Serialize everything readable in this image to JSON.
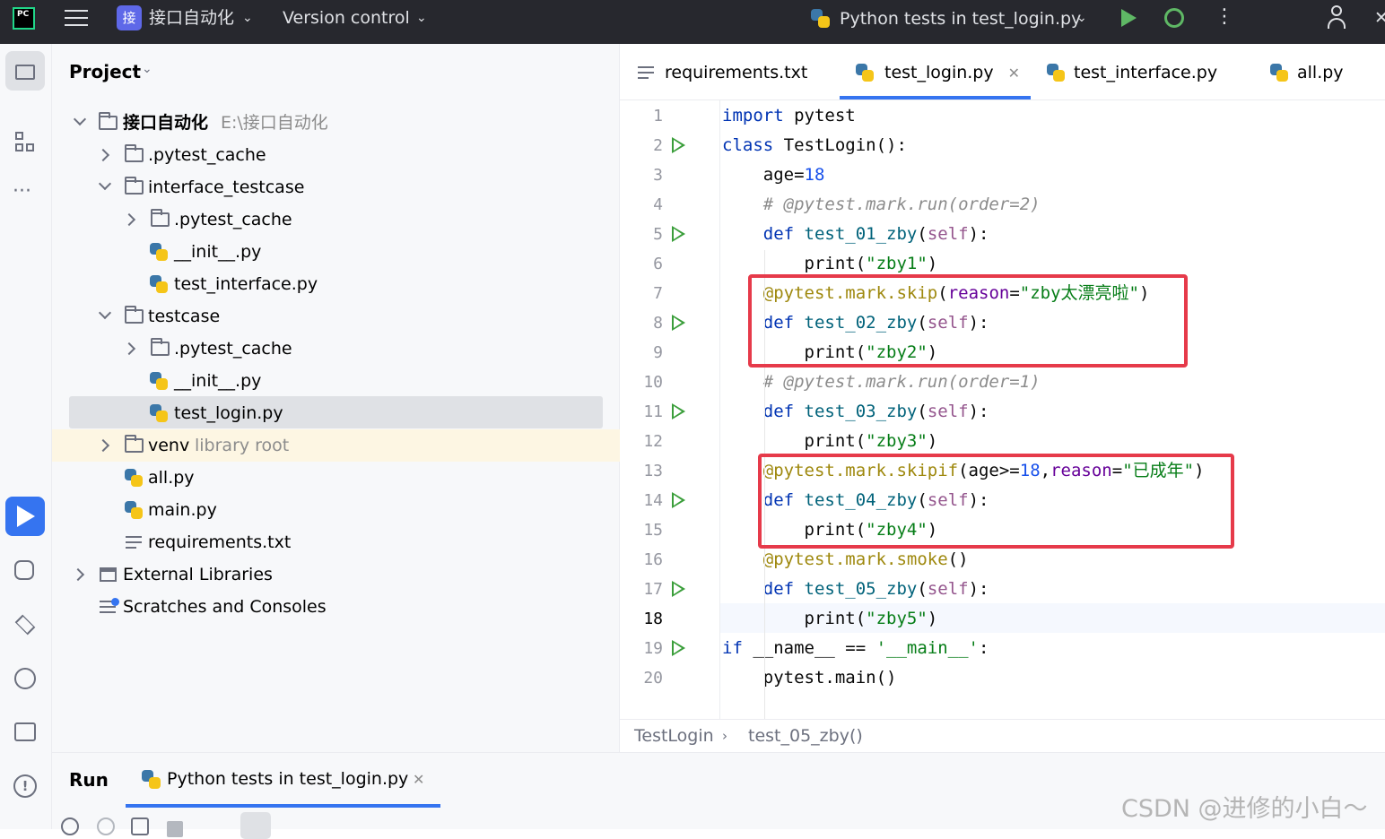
{
  "titlebar": {
    "project_badge": "接",
    "project_name": "接口自动化",
    "vcs_label": "Version control",
    "run_config": "Python tests in test_login.py"
  },
  "project_panel": {
    "title": "Project",
    "tree": [
      {
        "label": "接口自动化",
        "hint": "E:\\接口自动化"
      },
      {
        "label": ".pytest_cache"
      },
      {
        "label": "interface_testcase"
      },
      {
        "label": ".pytest_cache"
      },
      {
        "label": "__init__.py"
      },
      {
        "label": "test_interface.py"
      },
      {
        "label": "testcase"
      },
      {
        "label": ".pytest_cache"
      },
      {
        "label": "__init__.py"
      },
      {
        "label": "test_login.py"
      },
      {
        "label": "venv",
        "hint": "library root"
      },
      {
        "label": "all.py"
      },
      {
        "label": "main.py"
      },
      {
        "label": "requirements.txt"
      },
      {
        "label": "External Libraries"
      },
      {
        "label": "Scratches and Consoles"
      }
    ]
  },
  "editor": {
    "tabs": [
      "requirements.txt",
      "test_login.py",
      "test_interface.py",
      "all.py"
    ],
    "active_tab": "test_login.py",
    "line_numbers": [
      "1",
      "2",
      "3",
      "4",
      "5",
      "6",
      "7",
      "8",
      "9",
      "10",
      "11",
      "12",
      "13",
      "14",
      "15",
      "16",
      "17",
      "18",
      "19",
      "20"
    ],
    "code": {
      "l1": [
        "import",
        " pytest"
      ],
      "l2": [
        "class",
        " TestLogin():"
      ],
      "l3": [
        "    age=",
        "18"
      ],
      "l4": [
        "    # @pytest.mark.run(order=2)"
      ],
      "l5": [
        "    ",
        "def",
        " ",
        "test_01_zby",
        "(",
        "self",
        "):"
      ],
      "l6": [
        "        print(",
        "\"zby1\"",
        ")"
      ],
      "l7": [
        "    ",
        "@pytest.mark.skip",
        "(",
        "reason",
        "=",
        "\"zby太漂亮啦\"",
        ")"
      ],
      "l8": [
        "    ",
        "def",
        " ",
        "test_02_zby",
        "(",
        "self",
        "):"
      ],
      "l9": [
        "        print(",
        "\"zby2\"",
        ")"
      ],
      "l10": [
        "    # @pytest.mark.run(order=1)"
      ],
      "l11": [
        "    ",
        "def",
        " ",
        "test_03_zby",
        "(",
        "self",
        "):"
      ],
      "l12": [
        "        print(",
        "\"zby3\"",
        ")"
      ],
      "l13": [
        "    ",
        "@pytest.mark.skipif",
        "(age>=",
        "18",
        ",",
        "reason",
        "=",
        "\"已成年\"",
        ")"
      ],
      "l14": [
        "    ",
        "def",
        " ",
        "test_04_zby",
        "(",
        "self",
        "):"
      ],
      "l15": [
        "        print(",
        "\"zby4\"",
        ")"
      ],
      "l16": [
        "    ",
        "@pytest.mark.smoke",
        "()"
      ],
      "l17": [
        "    ",
        "def",
        " ",
        "test_05_zby",
        "(",
        "self",
        "):"
      ],
      "l18": [
        "        print(",
        "\"zby5\"",
        ")"
      ],
      "l19": [
        "if",
        " __name__ == ",
        "'__main__'",
        ":"
      ],
      "l20": [
        "    pytest.main()"
      ]
    }
  },
  "breadcrumb": [
    "TestLogin",
    "test_05_zby()"
  ],
  "run_panel": {
    "title": "Run",
    "tab": "Python tests in test_login.py"
  },
  "watermark": "CSDN @进修的小白～",
  "colors": {
    "highlight_box": "#e63a4a",
    "run_gutter": "#3a9e3a",
    "titlebar_bg": "#27282e"
  }
}
